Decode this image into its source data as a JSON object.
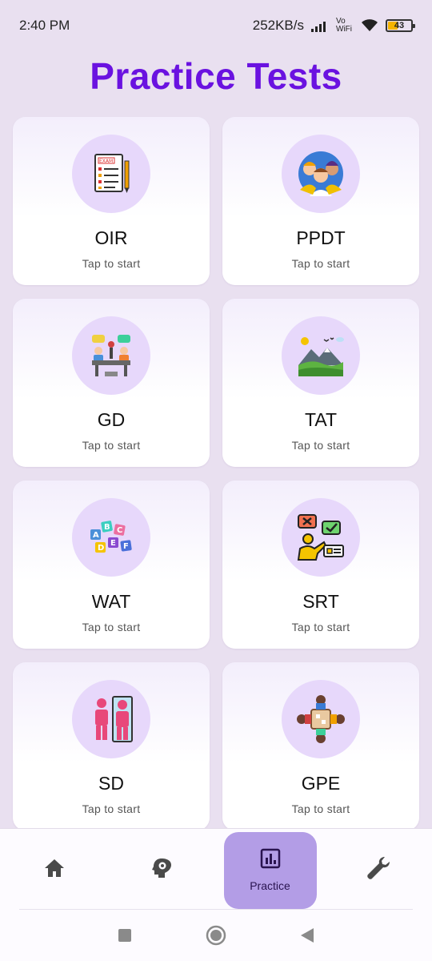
{
  "status_bar": {
    "time": "2:40 PM",
    "network_speed": "252KB/s",
    "vowifi": "Vo WiFi",
    "battery": "43"
  },
  "page": {
    "title": "Practice Tests"
  },
  "tests": [
    {
      "name": "OIR",
      "subtitle": "Tap to start",
      "icon": "exam-sheet-icon"
    },
    {
      "name": "PPDT",
      "subtitle": "Tap to start",
      "icon": "group-people-icon"
    },
    {
      "name": "GD",
      "subtitle": "Tap to start",
      "icon": "discussion-table-icon"
    },
    {
      "name": "TAT",
      "subtitle": "Tap to start",
      "icon": "landscape-picture-icon"
    },
    {
      "name": "WAT",
      "subtitle": "Tap to start",
      "icon": "alphabet-blocks-icon"
    },
    {
      "name": "SRT",
      "subtitle": "Tap to start",
      "icon": "situation-reaction-icon"
    },
    {
      "name": "SD",
      "subtitle": "Tap to start",
      "icon": "mirror-self-icon"
    },
    {
      "name": "GPE",
      "subtitle": "Tap to start",
      "icon": "group-planning-icon"
    }
  ],
  "bottom_nav": {
    "items": [
      {
        "icon": "home-icon",
        "label": ""
      },
      {
        "icon": "brain-gear-icon",
        "label": ""
      },
      {
        "icon": "bar-chart-icon",
        "label": "Practice",
        "active": true
      },
      {
        "icon": "wrench-icon",
        "label": ""
      }
    ]
  },
  "system_nav": [
    "recents-square-icon",
    "home-circle-icon",
    "back-triangle-icon"
  ],
  "colors": {
    "accent": "#6a12e0",
    "active_nav": "#b39de6",
    "background": "#e9e0f0"
  }
}
